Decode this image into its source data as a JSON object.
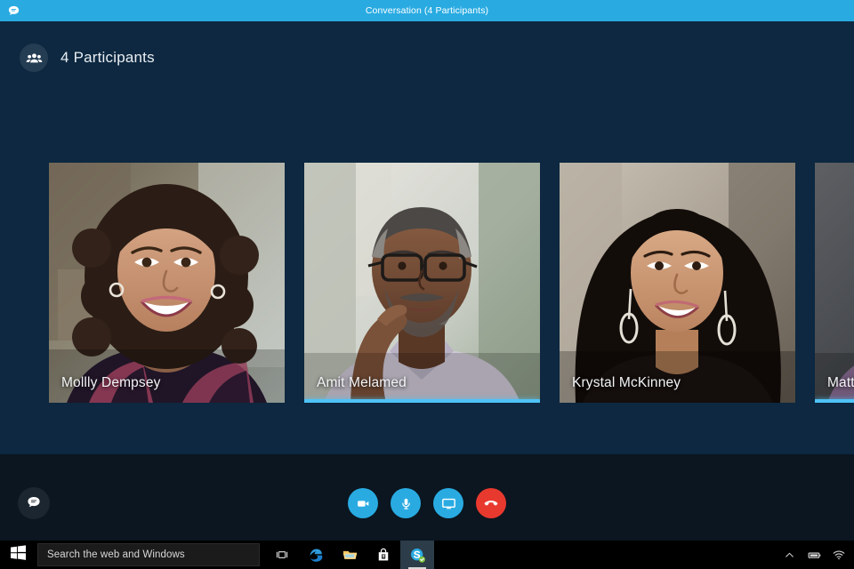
{
  "window": {
    "title": "Conversation (4 Participants)",
    "title_icon": "chat-bubble-icon",
    "titlebar_color": "#29abe2"
  },
  "stage": {
    "background_color": "#0d2840",
    "participants_icon": "people-group-icon",
    "participants_label": "4 Participants"
  },
  "participants": [
    {
      "name": "Mollly Dempsey",
      "speaking": false,
      "accent_color": "#4fc3f7"
    },
    {
      "name": "Amit Melamed",
      "speaking": true,
      "accent_color": "#4fc3f7"
    },
    {
      "name": "Krystal McKinney",
      "speaking": false,
      "accent_color": "#4fc3f7"
    },
    {
      "name": "Matthew To",
      "speaking": true,
      "accent_color": "#4fc3f7"
    }
  ],
  "controls": {
    "chat_toggle": {
      "label": "Chat",
      "icon": "chat-bubble-icon"
    },
    "buttons": [
      {
        "label": "Video",
        "icon": "video-camera-icon",
        "color": "#29abe2"
      },
      {
        "label": "Microphone",
        "icon": "microphone-icon",
        "color": "#29abe2"
      },
      {
        "label": "Share screen",
        "icon": "monitor-icon",
        "color": "#29abe2"
      },
      {
        "label": "End call",
        "icon": "hang-up-phone-icon",
        "color": "#e8392f"
      }
    ]
  },
  "taskbar": {
    "start": {
      "label": "Start",
      "icon": "windows-logo-icon"
    },
    "search": {
      "placeholder": "Search the web and Windows",
      "value": ""
    },
    "items": [
      {
        "label": "Task View",
        "icon": "task-view-icon",
        "active": false
      },
      {
        "label": "Microsoft Edge",
        "icon": "edge-browser-icon",
        "active": false
      },
      {
        "label": "File Explorer",
        "icon": "folder-icon",
        "active": false
      },
      {
        "label": "Store",
        "icon": "shopping-bag-icon",
        "active": false
      },
      {
        "label": "Skype",
        "icon": "skype-icon",
        "active": true
      }
    ],
    "tray": [
      {
        "label": "Show hidden icons",
        "icon": "chevron-up-icon"
      },
      {
        "label": "Battery",
        "icon": "battery-icon"
      },
      {
        "label": "Network",
        "icon": "wifi-icon"
      }
    ]
  }
}
